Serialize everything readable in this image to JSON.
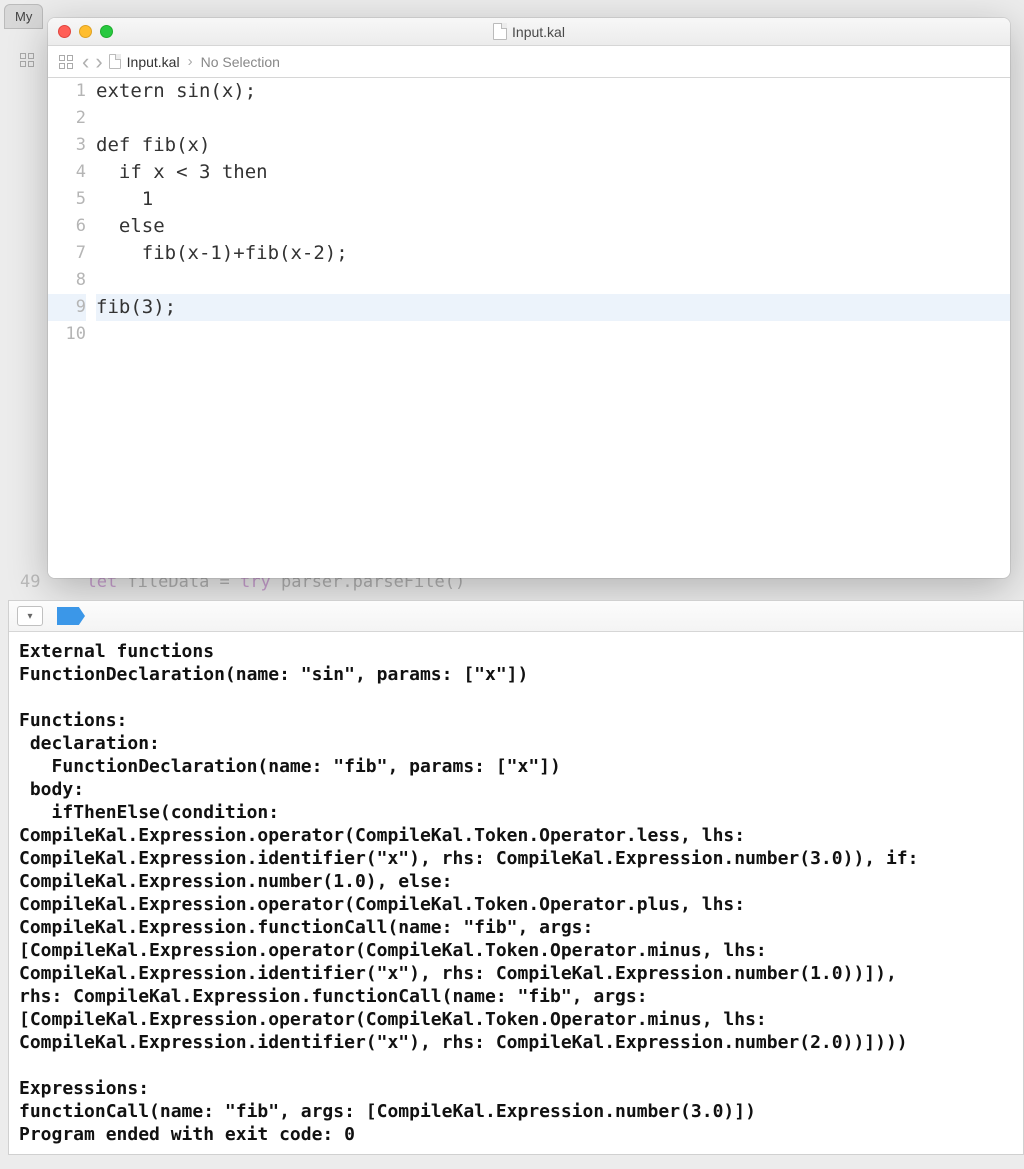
{
  "background": {
    "tab_label": "My",
    "hidden_line_num": "49",
    "hidden_code_let": "let",
    "hidden_code_rest": " fileData = ",
    "hidden_code_try": "try",
    "hidden_code_end": " parser.parseFile()"
  },
  "window": {
    "title": "Input.kal"
  },
  "breadcrumb": {
    "file": "Input.kal",
    "selection": "No Selection"
  },
  "source": {
    "lines": [
      {
        "num": "1",
        "text": "extern sin(x);",
        "hl": false
      },
      {
        "num": "2",
        "text": "",
        "hl": false
      },
      {
        "num": "3",
        "text": "def fib(x)",
        "hl": false
      },
      {
        "num": "4",
        "text": "  if x < 3 then",
        "hl": false
      },
      {
        "num": "5",
        "text": "    1",
        "hl": false
      },
      {
        "num": "6",
        "text": "  else",
        "hl": false
      },
      {
        "num": "7",
        "text": "    fib(x-1)+fib(x-2);",
        "hl": false
      },
      {
        "num": "8",
        "text": "",
        "hl": false
      },
      {
        "num": "9",
        "text": "fib(3);",
        "hl": true
      },
      {
        "num": "10",
        "text": "",
        "hl": false
      }
    ]
  },
  "console": {
    "output": "External functions\nFunctionDeclaration(name: \"sin\", params: [\"x\"])\n\nFunctions:\n declaration:\n   FunctionDeclaration(name: \"fib\", params: [\"x\"])\n body:\n   ifThenElse(condition:\nCompileKal.Expression.operator(CompileKal.Token.Operator.less, lhs:\nCompileKal.Expression.identifier(\"x\"), rhs: CompileKal.Expression.number(3.0)), if:\nCompileKal.Expression.number(1.0), else:\nCompileKal.Expression.operator(CompileKal.Token.Operator.plus, lhs:\nCompileKal.Expression.functionCall(name: \"fib\", args:\n[CompileKal.Expression.operator(CompileKal.Token.Operator.minus, lhs:\nCompileKal.Expression.identifier(\"x\"), rhs: CompileKal.Expression.number(1.0))]),\nrhs: CompileKal.Expression.functionCall(name: \"fib\", args:\n[CompileKal.Expression.operator(CompileKal.Token.Operator.minus, lhs:\nCompileKal.Expression.identifier(\"x\"), rhs: CompileKal.Expression.number(2.0))])))\n\nExpressions:\nfunctionCall(name: \"fib\", args: [CompileKal.Expression.number(3.0)])\nProgram ended with exit code: 0"
  }
}
